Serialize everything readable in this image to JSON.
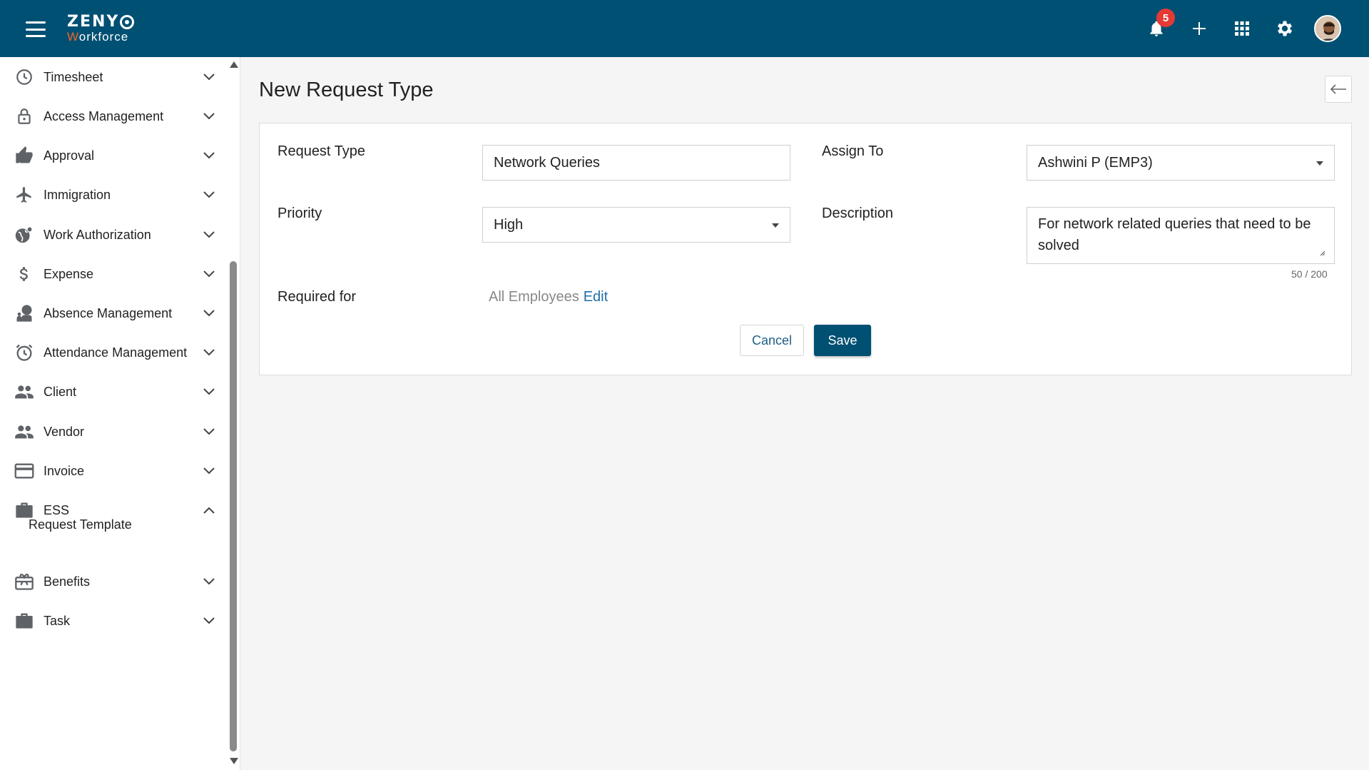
{
  "header": {
    "logo_top": "ZENY",
    "logo_bottom_first": "W",
    "logo_bottom_rest": "orkforce",
    "notification_count": "5",
    "accent_color": "#005073",
    "badge_color": "#e53935"
  },
  "sidebar": {
    "items": [
      {
        "label": "Timesheet",
        "icon": "clock-icon"
      },
      {
        "label": "Access Management",
        "icon": "lock-icon"
      },
      {
        "label": "Approval",
        "icon": "thumbs-up-icon"
      },
      {
        "label": "Immigration",
        "icon": "airplane-icon"
      },
      {
        "label": "Work Authorization",
        "icon": "globe-person-icon"
      },
      {
        "label": "Expense",
        "icon": "dollar-icon"
      },
      {
        "label": "Absence Management",
        "icon": "person-leave-icon"
      },
      {
        "label": "Attendance Management",
        "icon": "alarm-clock-icon"
      },
      {
        "label": "Client",
        "icon": "people-icon"
      },
      {
        "label": "Vendor",
        "icon": "people-icon"
      },
      {
        "label": "Invoice",
        "icon": "credit-card-icon"
      },
      {
        "label": "ESS",
        "icon": "briefcase-icon",
        "expanded": true
      },
      {
        "label": "Benefits",
        "icon": "gift-card-icon"
      },
      {
        "label": "Task",
        "icon": "briefcase-icon"
      }
    ],
    "ess_subitem": "Request Template"
  },
  "main": {
    "title": "New Request Type",
    "form": {
      "request_type_label": "Request Type",
      "request_type_value": "Network Queries",
      "assign_to_label": "Assign To",
      "assign_to_value": "Ashwini P (EMP3)",
      "priority_label": "Priority",
      "priority_value": "High",
      "description_label": "Description",
      "description_value": "For network related queries that need to be solved",
      "description_counter": "50 / 200",
      "required_for_label": "Required for",
      "required_for_value": "All Employees",
      "required_for_edit": "Edit",
      "cancel_label": "Cancel",
      "save_label": "Save"
    }
  }
}
